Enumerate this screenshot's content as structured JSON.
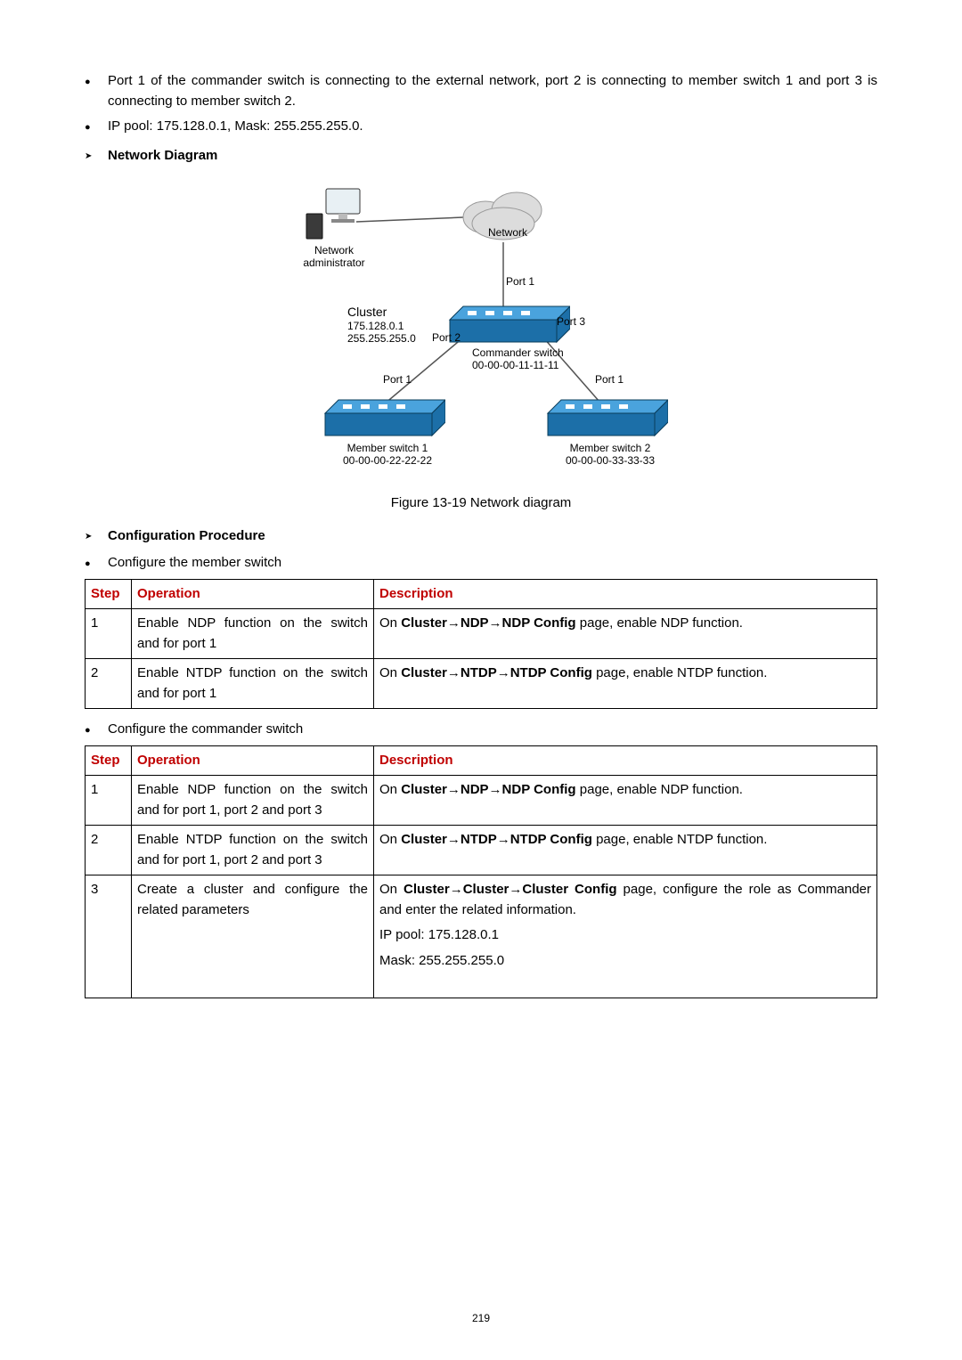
{
  "bullets_top": [
    "Port 1 of the commander switch is connecting to the external network, port 2 is connecting to member switch 1 and port 3 is connecting to member switch 2.",
    "IP pool: 175.128.0.1, Mask: 255.255.255.0."
  ],
  "section_network_diagram": "Network Diagram",
  "section_config_procedure": "Configuration Procedure",
  "caption": "Figure 13-19 Network diagram",
  "bullet_member": "Configure the member switch",
  "bullet_commander": "Configure the commander switch",
  "table_headers": {
    "step": "Step",
    "operation": "Operation",
    "description": "Description"
  },
  "diagram_labels": {
    "network": "Network",
    "admin": "Network\nadministrator",
    "cluster": "Cluster",
    "cluster_ip": "175.128.0.1",
    "cluster_mask": "255.255.255.0",
    "port1": "Port 1",
    "port2": "Port 2",
    "port3": "Port 3",
    "commander": "Commander switch\n00-00-00-11-11-11",
    "member1": "Member switch 1\n00-00-00-22-22-22",
    "member2": "Member switch 2\n00-00-00-33-33-33"
  },
  "table_member": [
    {
      "step": "1",
      "operation": "Enable NDP function on the switch and for port 1",
      "desc_pre": "On ",
      "desc_bold": "Cluster→NDP→NDP Config",
      "desc_post": " page, enable NDP function."
    },
    {
      "step": "2",
      "operation": "Enable NTDP function on the switch and for port 1",
      "desc_pre": "On ",
      "desc_bold": "Cluster→NTDP→NTDP Config",
      "desc_post": " page, enable NTDP function."
    }
  ],
  "table_commander": [
    {
      "step": "1",
      "operation": "Enable NDP function on the switch and for port 1, port 2 and port 3",
      "desc_pre": "On ",
      "desc_bold": "Cluster→NDP→NDP Config",
      "desc_post": " page, enable NDP function."
    },
    {
      "step": "2",
      "operation": "Enable NTDP function on the switch and for port 1, port 2 and port 3",
      "desc_pre": "On ",
      "desc_bold": "Cluster→NTDP→NTDP Config",
      "desc_post": " page, enable NTDP function."
    },
    {
      "step": "3",
      "operation": "Create a cluster and configure the related parameters",
      "desc_pre": "On ",
      "desc_bold": "Cluster→Cluster→Cluster Config",
      "desc_post": " page, configure the role as Commander and enter the related information.",
      "extra1": "IP pool: 175.128.0.1",
      "extra2": "Mask: 255.255.255.0"
    }
  ],
  "page_number": "219"
}
